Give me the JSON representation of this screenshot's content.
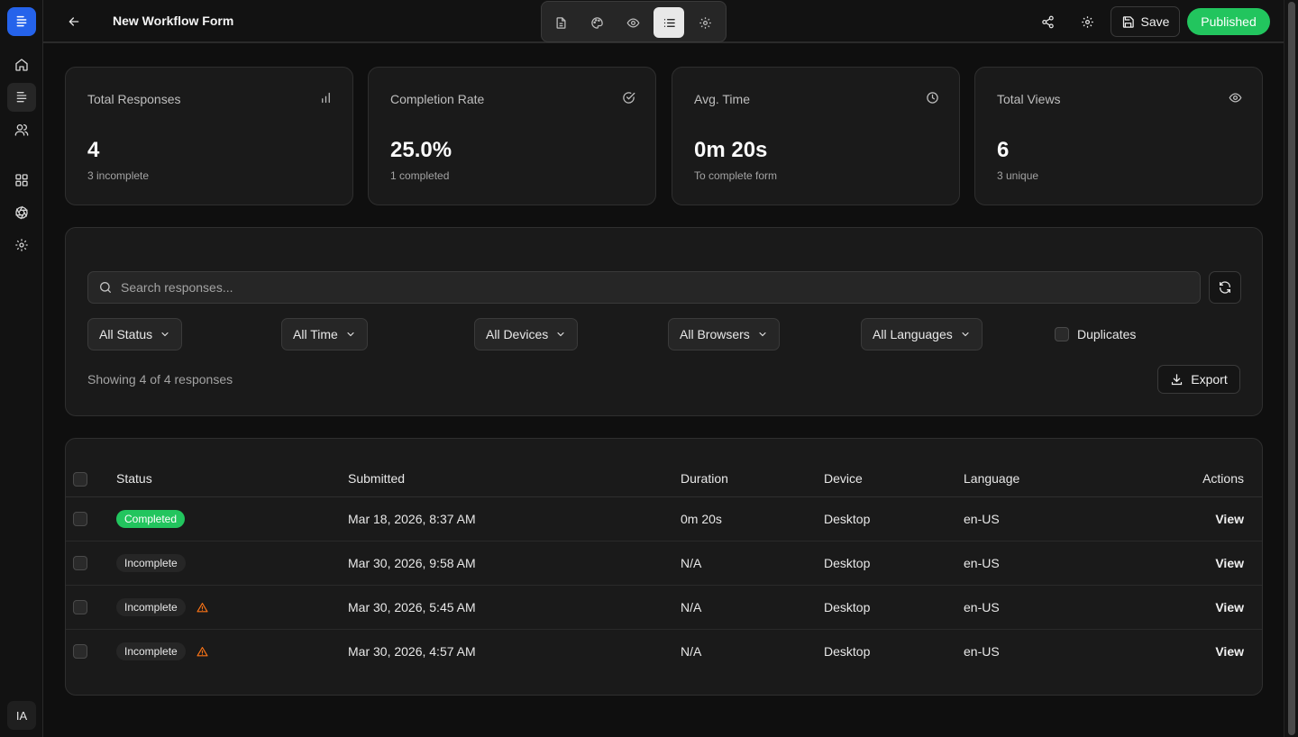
{
  "header": {
    "title": "New Workflow Form",
    "save_label": "Save",
    "published_label": "Published"
  },
  "sidebar": {
    "avatar_initials": "IA"
  },
  "stats": [
    {
      "label": "Total Responses",
      "value": "4",
      "sub": "3 incomplete",
      "icon": "bar-chart-icon"
    },
    {
      "label": "Completion Rate",
      "value": "25.0%",
      "sub": "1 completed",
      "icon": "check-circle-icon"
    },
    {
      "label": "Avg. Time",
      "value": "0m 20s",
      "sub": "To complete form",
      "icon": "clock-icon"
    },
    {
      "label": "Total Views",
      "value": "6",
      "sub": "3 unique",
      "icon": "eye-icon"
    }
  ],
  "filters": {
    "search_placeholder": "Search responses...",
    "status": "All Status",
    "time": "All Time",
    "devices": "All Devices",
    "browsers": "All Browsers",
    "languages": "All Languages",
    "duplicates_label": "Duplicates",
    "showing_text": "Showing 4 of 4 responses",
    "export_label": "Export"
  },
  "table": {
    "columns": [
      "Status",
      "Submitted",
      "Duration",
      "Device",
      "Language",
      "Actions"
    ],
    "rows": [
      {
        "status": "Completed",
        "submitted": "Mar 18, 2026, 8:37 AM",
        "duration": "0m 20s",
        "device": "Desktop",
        "language": "en-US",
        "action": "View",
        "warning": false
      },
      {
        "status": "Incomplete",
        "submitted": "Mar 30, 2026, 9:58 AM",
        "duration": "N/A",
        "device": "Desktop",
        "language": "en-US",
        "action": "View",
        "warning": false
      },
      {
        "status": "Incomplete",
        "submitted": "Mar 30, 2026, 5:45 AM",
        "duration": "N/A",
        "device": "Desktop",
        "language": "en-US",
        "action": "View",
        "warning": true
      },
      {
        "status": "Incomplete",
        "submitted": "Mar 30, 2026, 4:57 AM",
        "duration": "N/A",
        "device": "Desktop",
        "language": "en-US",
        "action": "View",
        "warning": true
      }
    ]
  },
  "colors": {
    "accent_blue": "#2563eb",
    "success_green": "#22c55e",
    "warning_orange": "#f97316",
    "background": "#0f0f0f",
    "card": "#1a1a1a"
  }
}
